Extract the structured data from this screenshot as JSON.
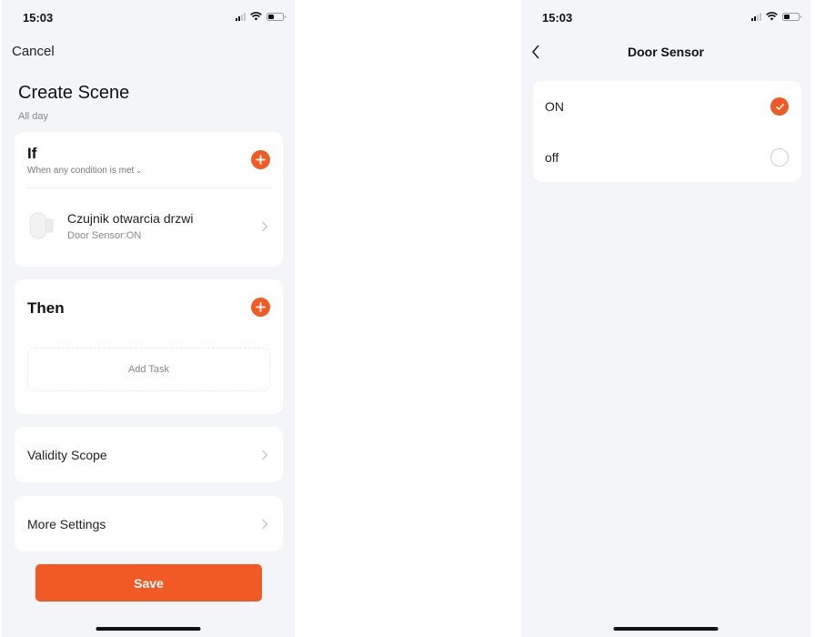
{
  "colors": {
    "accent": "#f15a24",
    "background": "#f4f5f9",
    "card": "#ffffff"
  },
  "left_screen": {
    "status_bar": {
      "time": "15:03",
      "battery_level": 0.35
    },
    "cancel_label": "Cancel",
    "title": "Create Scene",
    "subtitle": "All day",
    "if_section": {
      "title": "If",
      "condition_mode": "When any condition is met",
      "add_icon": "plus-circle-icon",
      "conditions": [
        {
          "name": "Czujnik otwarcia drzwi",
          "state": "Door Sensor:ON",
          "icon": "door-sensor-icon"
        }
      ]
    },
    "then_section": {
      "title": "Then",
      "add_icon": "plus-circle-icon",
      "add_task_label": "Add Task"
    },
    "validity_scope_label": "Validity Scope",
    "more_settings_label": "More Settings",
    "save_label": "Save"
  },
  "right_screen": {
    "status_bar": {
      "time": "15:03",
      "battery_level": 0.35
    },
    "title": "Door Sensor",
    "options": [
      {
        "label": "ON",
        "selected": true
      },
      {
        "label": "off",
        "selected": false
      }
    ]
  }
}
